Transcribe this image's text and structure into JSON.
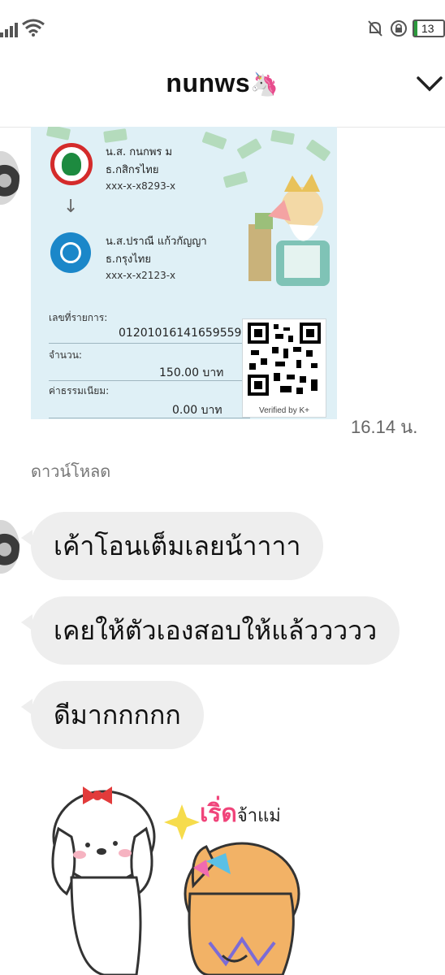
{
  "status_bar": {
    "battery": "13"
  },
  "header": {
    "title": "nunws",
    "title_emoji": "🦄"
  },
  "slip": {
    "sender_name": "น.ส. กนกพร ม",
    "sender_bank": "ธ.กสิกรไทย",
    "sender_account": "xxx-x-x8293-x",
    "receiver_name": "น.ส.ปราณี แก้วกัญญา",
    "receiver_bank": "ธ.กรุงไทย",
    "receiver_account": "xxx-x-x2123-x",
    "ref_label": "เลขที่รายการ:",
    "ref_value": "012010161416595591",
    "amount_label": "จำนวน:",
    "amount_value": "150.00 บาท",
    "fee_label": "ค่าธรรมเนียม:",
    "fee_value": "0.00 บาท",
    "qr_caption": "Verified by K+"
  },
  "message_time": "16.14 น.",
  "download_label": "ดาวน์โหลด",
  "messages": [
    "เค้าโอนเต็มเลยน้าาาา",
    "เคยให้ตัวเองสอบให้แล้ววววว",
    "ดีมากกกกก"
  ],
  "sticker": {
    "text_pink": "เริ่ด",
    "text_rest": "จ้าแม่"
  },
  "colors": {
    "bubble_bg": "#eeeeee",
    "kbank_green": "#1d8a3f",
    "ktb_blue": "#1b87c9",
    "sticker_pink": "#f0447a"
  }
}
